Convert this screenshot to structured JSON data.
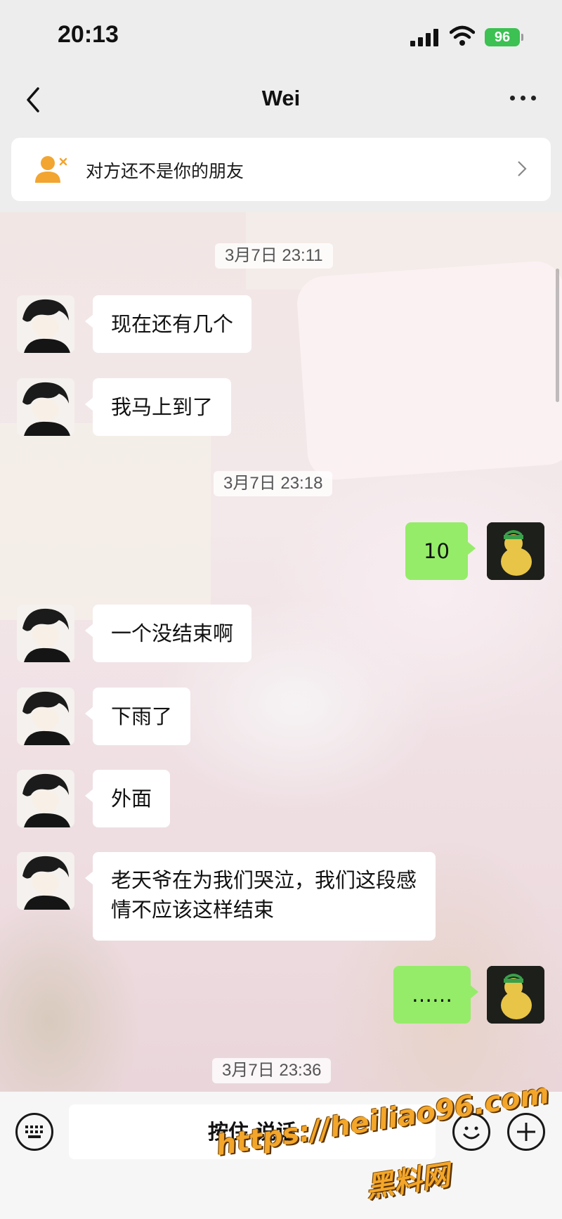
{
  "status_bar": {
    "time": "20:13",
    "battery": "96"
  },
  "nav": {
    "title": "Wei"
  },
  "banner": {
    "text": "对方还不是你的朋友"
  },
  "messages": [
    {
      "type": "timestamp",
      "text": "3月7日 23:11"
    },
    {
      "type": "received",
      "text": "现在还有几个"
    },
    {
      "type": "received",
      "text": "我马上到了"
    },
    {
      "type": "timestamp",
      "text": "3月7日 23:18"
    },
    {
      "type": "sent",
      "text": "10"
    },
    {
      "type": "received",
      "text": "一个没结束啊"
    },
    {
      "type": "received",
      "text": "下雨了"
    },
    {
      "type": "received",
      "text": "外面"
    },
    {
      "type": "received",
      "line1": "老天爷在为我们哭泣，我们这段感",
      "line2": "情不应该这样结束"
    },
    {
      "type": "sent",
      "text": "……"
    },
    {
      "type": "timestamp",
      "text": "3月7日 23:36"
    }
  ],
  "input_bar": {
    "hold_to_talk": "按住 说话"
  },
  "watermark": {
    "url": "https://heiliao96.com",
    "site": "黑料网"
  },
  "colors": {
    "sent_bubble": "#95ec69",
    "received_bubble": "#ffffff",
    "battery": "#3cc152"
  },
  "icons": [
    "back-icon",
    "more-icon",
    "user-x-icon",
    "chevron-right-icon",
    "keyboard-icon",
    "emoji-icon",
    "plus-icon"
  ]
}
